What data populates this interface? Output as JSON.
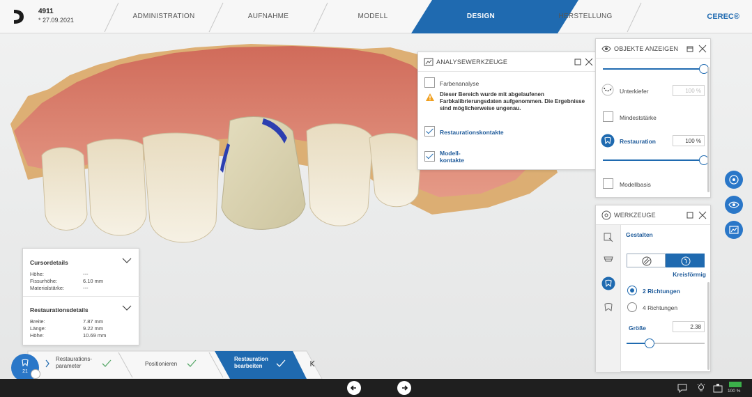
{
  "header": {
    "case_id": "4911",
    "case_date": "* 27.09.2021",
    "steps": [
      "ADMINISTRATION",
      "AUFNAHME",
      "MODELL",
      "DESIGN",
      "HERSTELLUNG"
    ],
    "active_step": "DESIGN",
    "brand": "CEREC®"
  },
  "analysis_panel": {
    "title": "ANALYSEWERKZEUGE",
    "items": {
      "color_analysis": "Farbenanalyse",
      "warning": [
        "Dieser Bereich wurde mit abgelaufenen",
        "Farbkalibrierungsdaten aufgenommen. Die Ergebnisse",
        "sind möglicherweise ungenau."
      ],
      "restoration_contacts": "Restaurationskontakte",
      "model_contacts": [
        "Modell-",
        "kontakte"
      ]
    }
  },
  "objects_panel": {
    "title": "OBJEKTE ANZEIGEN",
    "unterkiefer": {
      "label": "Unterkiefer",
      "value": "100 %"
    },
    "mindeststaerke": "Mindeststärke",
    "restauration": {
      "label": "Restauration",
      "value": "100 %"
    },
    "modellbasis": "Modellbasis",
    "opacity_top": 1.0,
    "opacity_restoration": 1.0
  },
  "tools_panel": {
    "title": "WERKZEUGE",
    "section": "Gestalten",
    "mode": "Kreisförmig",
    "options": [
      "2 Richtungen",
      "4 Richtungen"
    ],
    "selected_option": "2 Richtungen",
    "size_label": "Größe",
    "size_value": "2.38",
    "size_level": 0.27
  },
  "cursor_details": {
    "title": "Cursordetails",
    "rows": [
      [
        "Höhe:",
        "---"
      ],
      [
        "Fissurhöhe:",
        "6.10 mm"
      ],
      [
        "Materialstärke:",
        "---"
      ]
    ]
  },
  "restoration_details": {
    "title": "Restaurationsdetails",
    "rows": [
      [
        "Breite:",
        "7.87 mm"
      ],
      [
        "Länge:",
        "9.22 mm"
      ],
      [
        "Höhe:",
        "10.69 mm"
      ]
    ]
  },
  "workflow": {
    "tooth_number": "21",
    "steps": [
      {
        "label": [
          "Restaurations-",
          "parameter"
        ]
      },
      {
        "label": [
          "Positionieren"
        ]
      },
      {
        "label": [
          "Restauration",
          "bearbeiten"
        ]
      }
    ]
  },
  "statusbar": {
    "battery": "100 %"
  },
  "colors": {
    "accent": "#1f6ab0",
    "active_step": "#2a77c8",
    "gum": "#d87a6c",
    "crown": "#ded7b5"
  }
}
